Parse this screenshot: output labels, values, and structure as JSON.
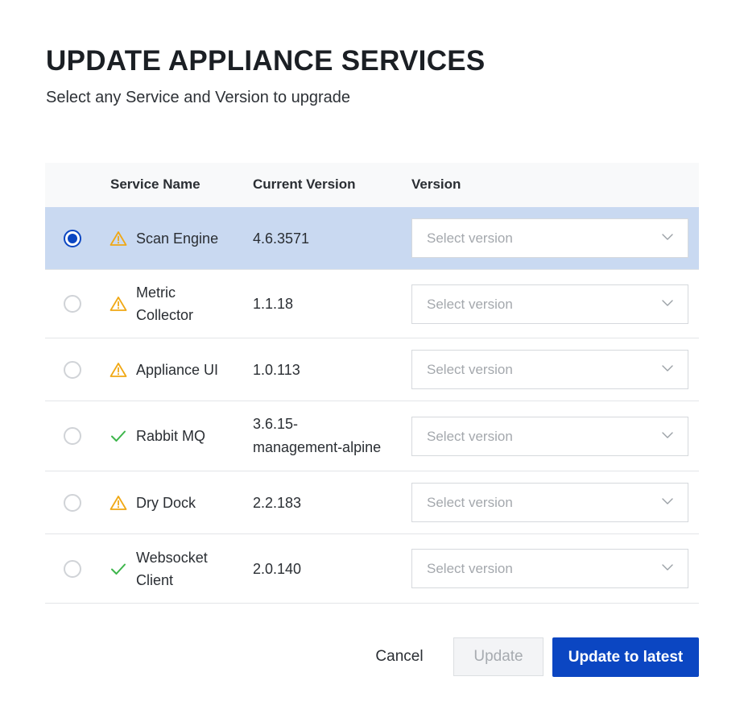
{
  "dialog": {
    "title": "UPDATE APPLIANCE SERVICES",
    "subtitle": "Select any Service and Version to upgrade"
  },
  "table": {
    "columns": {
      "service_name": "Service Name",
      "current_version": "Current Version",
      "version": "Version"
    },
    "rows": [
      {
        "name_line1": "Scan Engine",
        "name_line2": "",
        "current_line1": "4.6.3571",
        "current_line2": "",
        "status": "warning",
        "selected": true,
        "version_placeholder": "Select version"
      },
      {
        "name_line1": "Metric",
        "name_line2": "Collector",
        "current_line1": "1.1.18",
        "current_line2": "",
        "status": "warning",
        "selected": false,
        "version_placeholder": "Select version"
      },
      {
        "name_line1": "Appliance UI",
        "name_line2": "",
        "current_line1": "1.0.113",
        "current_line2": "",
        "status": "warning",
        "selected": false,
        "version_placeholder": "Select version"
      },
      {
        "name_line1": "Rabbit MQ",
        "name_line2": "",
        "current_line1": "3.6.15-",
        "current_line2": "management-alpine",
        "status": "ok",
        "selected": false,
        "version_placeholder": "Select version"
      },
      {
        "name_line1": "Dry Dock",
        "name_line2": "",
        "current_line1": "2.2.183",
        "current_line2": "",
        "status": "warning",
        "selected": false,
        "version_placeholder": "Select version"
      },
      {
        "name_line1": "Websocket",
        "name_line2": "Client",
        "current_line1": "2.0.140",
        "current_line2": "",
        "status": "ok",
        "selected": false,
        "version_placeholder": "Select version"
      }
    ]
  },
  "footer": {
    "cancel_label": "Cancel",
    "update_label": "Update",
    "update_latest_label": "Update to latest"
  },
  "colors": {
    "primary": "#0b46c2",
    "selected_row": "#c9d9f1",
    "warning": "#f0a814",
    "ok": "#3cb54a"
  },
  "icons": {
    "warning": "warning-icon",
    "ok": "checkmark-icon",
    "dropdown": "chevron-down-icon"
  }
}
